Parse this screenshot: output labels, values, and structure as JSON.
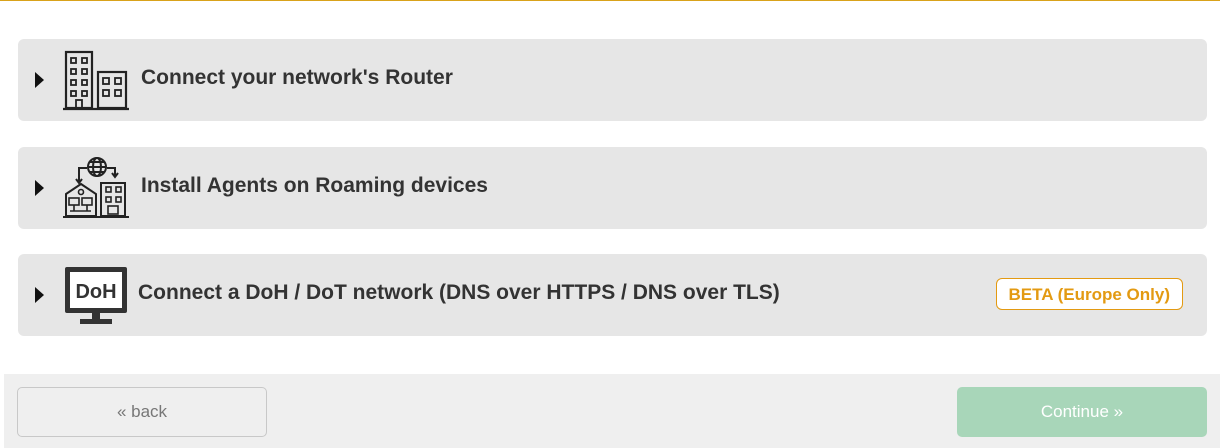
{
  "options": [
    {
      "title": "Connect your network's Router",
      "icon": "office-buildings-icon"
    },
    {
      "title": "Install Agents on Roaming devices",
      "icon": "globe-buildings-icon"
    },
    {
      "title": "Connect a DoH / DoT network (DNS over HTTPS / DNS over TLS)",
      "icon": "doh-monitor-icon",
      "icon_text": "DoH",
      "badge": "BETA (Europe Only)"
    }
  ],
  "footer": {
    "back_label": "« back",
    "continue_label": "Continue »"
  },
  "colors": {
    "accent": "#e39a12",
    "panel_bg": "#e6e6e6",
    "continue_bg": "#a8d6b9",
    "top_border": "#d9a21a"
  }
}
